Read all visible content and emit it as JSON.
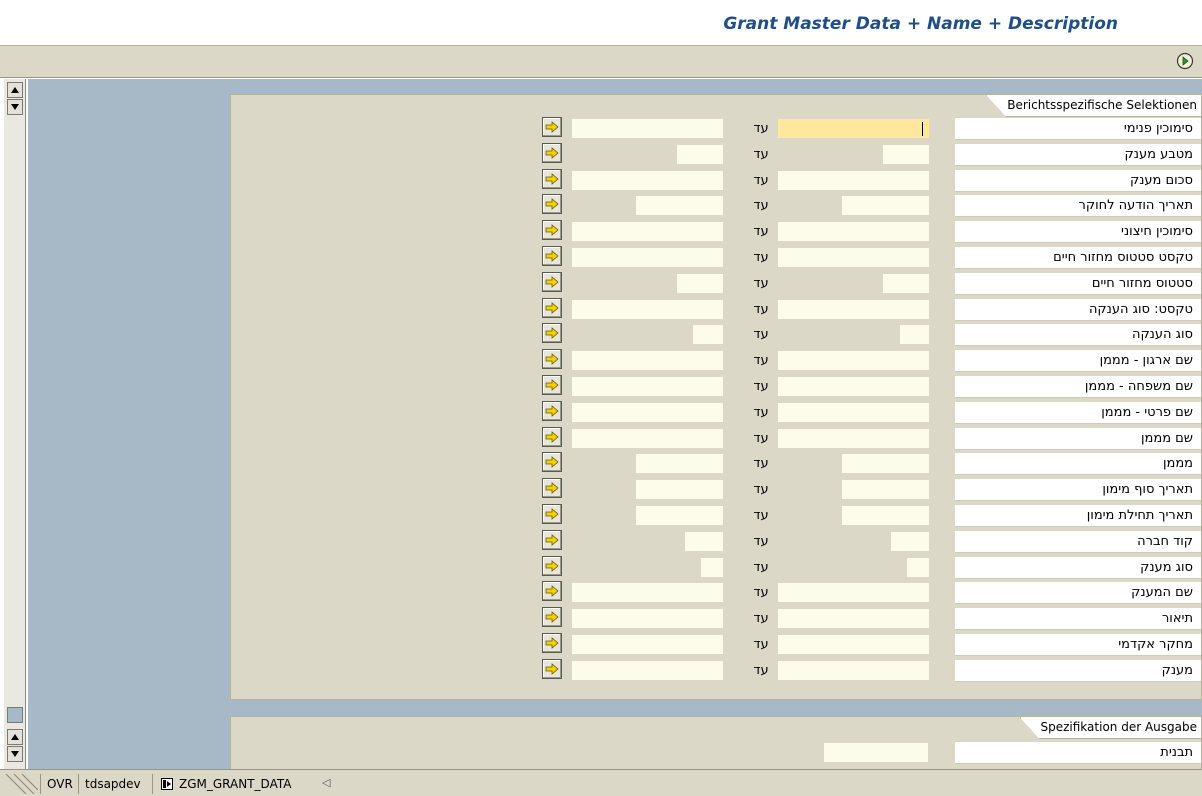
{
  "app_title": "Grant Master Data + Name + Description",
  "toolbar": {
    "execute_icon": "execute-clock-icon"
  },
  "selection_panel": {
    "tab_label": "Berichtsspezifische Selektionen",
    "to_label": "עד",
    "rows": [
      {
        "label": "סימוכין פנימי",
        "value_from": "",
        "value_to": "",
        "active": true
      },
      {
        "label": "מטבע מענק",
        "value_from": "",
        "value_to": ""
      },
      {
        "label": "סכום מענק",
        "value_from": "",
        "value_to": ""
      },
      {
        "label": "תאריך הודעה לחוקר",
        "value_from": "",
        "value_to": ""
      },
      {
        "label": "סימוכין חיצוני",
        "value_from": "",
        "value_to": ""
      },
      {
        "label": "טקסט סטטוס מחזור חיים",
        "value_from": "",
        "value_to": ""
      },
      {
        "label": "סטטוס מחזור חיים",
        "value_from": "",
        "value_to": ""
      },
      {
        "label": "טקסט: סוג הענקה",
        "value_from": "",
        "value_to": ""
      },
      {
        "label": "סוג הענקה",
        "value_from": "",
        "value_to": ""
      },
      {
        "label": "שם ארגון - מממן",
        "value_from": "",
        "value_to": ""
      },
      {
        "label": "שם משפחה - מממן",
        "value_from": "",
        "value_to": ""
      },
      {
        "label": "שם פרטי - מממן",
        "value_from": "",
        "value_to": ""
      },
      {
        "label": "שם מממן",
        "value_from": "",
        "value_to": ""
      },
      {
        "label": "מממן",
        "value_from": "",
        "value_to": ""
      },
      {
        "label": "תאריך סוף מימון",
        "value_from": "",
        "value_to": ""
      },
      {
        "label": "תאריך תחילת מימון",
        "value_from": "",
        "value_to": ""
      },
      {
        "label": "קוד חברה",
        "value_from": "",
        "value_to": ""
      },
      {
        "label": "סוג מענק",
        "value_from": "",
        "value_to": ""
      },
      {
        "label": "שם המענק",
        "value_from": "",
        "value_to": ""
      },
      {
        "label": "תיאור",
        "value_from": "",
        "value_to": ""
      },
      {
        "label": "מחקר אקדמי",
        "value_from": "",
        "value_to": ""
      },
      {
        "label": "מענק",
        "value_from": "",
        "value_to": ""
      }
    ]
  },
  "output_panel": {
    "tab_label": "Spezifikation der Ausgabe",
    "layout_label": "תבנית",
    "layout_value": ""
  },
  "statusbar": {
    "mode": "OVR",
    "system": "tdsapdev",
    "transaction": "ZGM_GRANT_DATA"
  },
  "colors": {
    "title": "#1f4f86",
    "panel_bg": "#dcd8c8",
    "workarea_bg": "#a7b8c7",
    "input_bg": "#fdfbea",
    "active_input_bg": "#ffe89c",
    "arrow_yellow": "#f2d200"
  }
}
